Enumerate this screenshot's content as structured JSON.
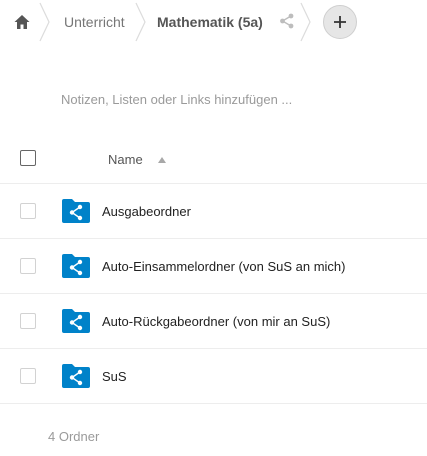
{
  "colors": {
    "folder_blue": "#0082c9",
    "chevron": "#dcdcdc",
    "text_muted": "#767676",
    "divider": "#ededed"
  },
  "breadcrumb": {
    "home_icon": "home-icon",
    "items": [
      {
        "label": "Unterricht"
      },
      {
        "label": "Mathematik (5a)"
      }
    ],
    "share_icon": "share-icon",
    "add_icon": "plus-icon"
  },
  "notes": {
    "placeholder": "Notizen, Listen oder Links hinzufügen ..."
  },
  "table": {
    "column_name": "Name",
    "sort_icon": "sort-ascending-icon",
    "rows": [
      {
        "name": "Ausgabeordner",
        "icon": "shared-folder-icon"
      },
      {
        "name": "Auto-Einsammelordner (von SuS an mich)",
        "icon": "shared-folder-icon"
      },
      {
        "name": "Auto-Rückgabeordner (von mir an SuS)",
        "icon": "shared-folder-icon"
      },
      {
        "name": "SuS",
        "icon": "shared-folder-icon"
      }
    ],
    "summary": "4 Ordner"
  }
}
